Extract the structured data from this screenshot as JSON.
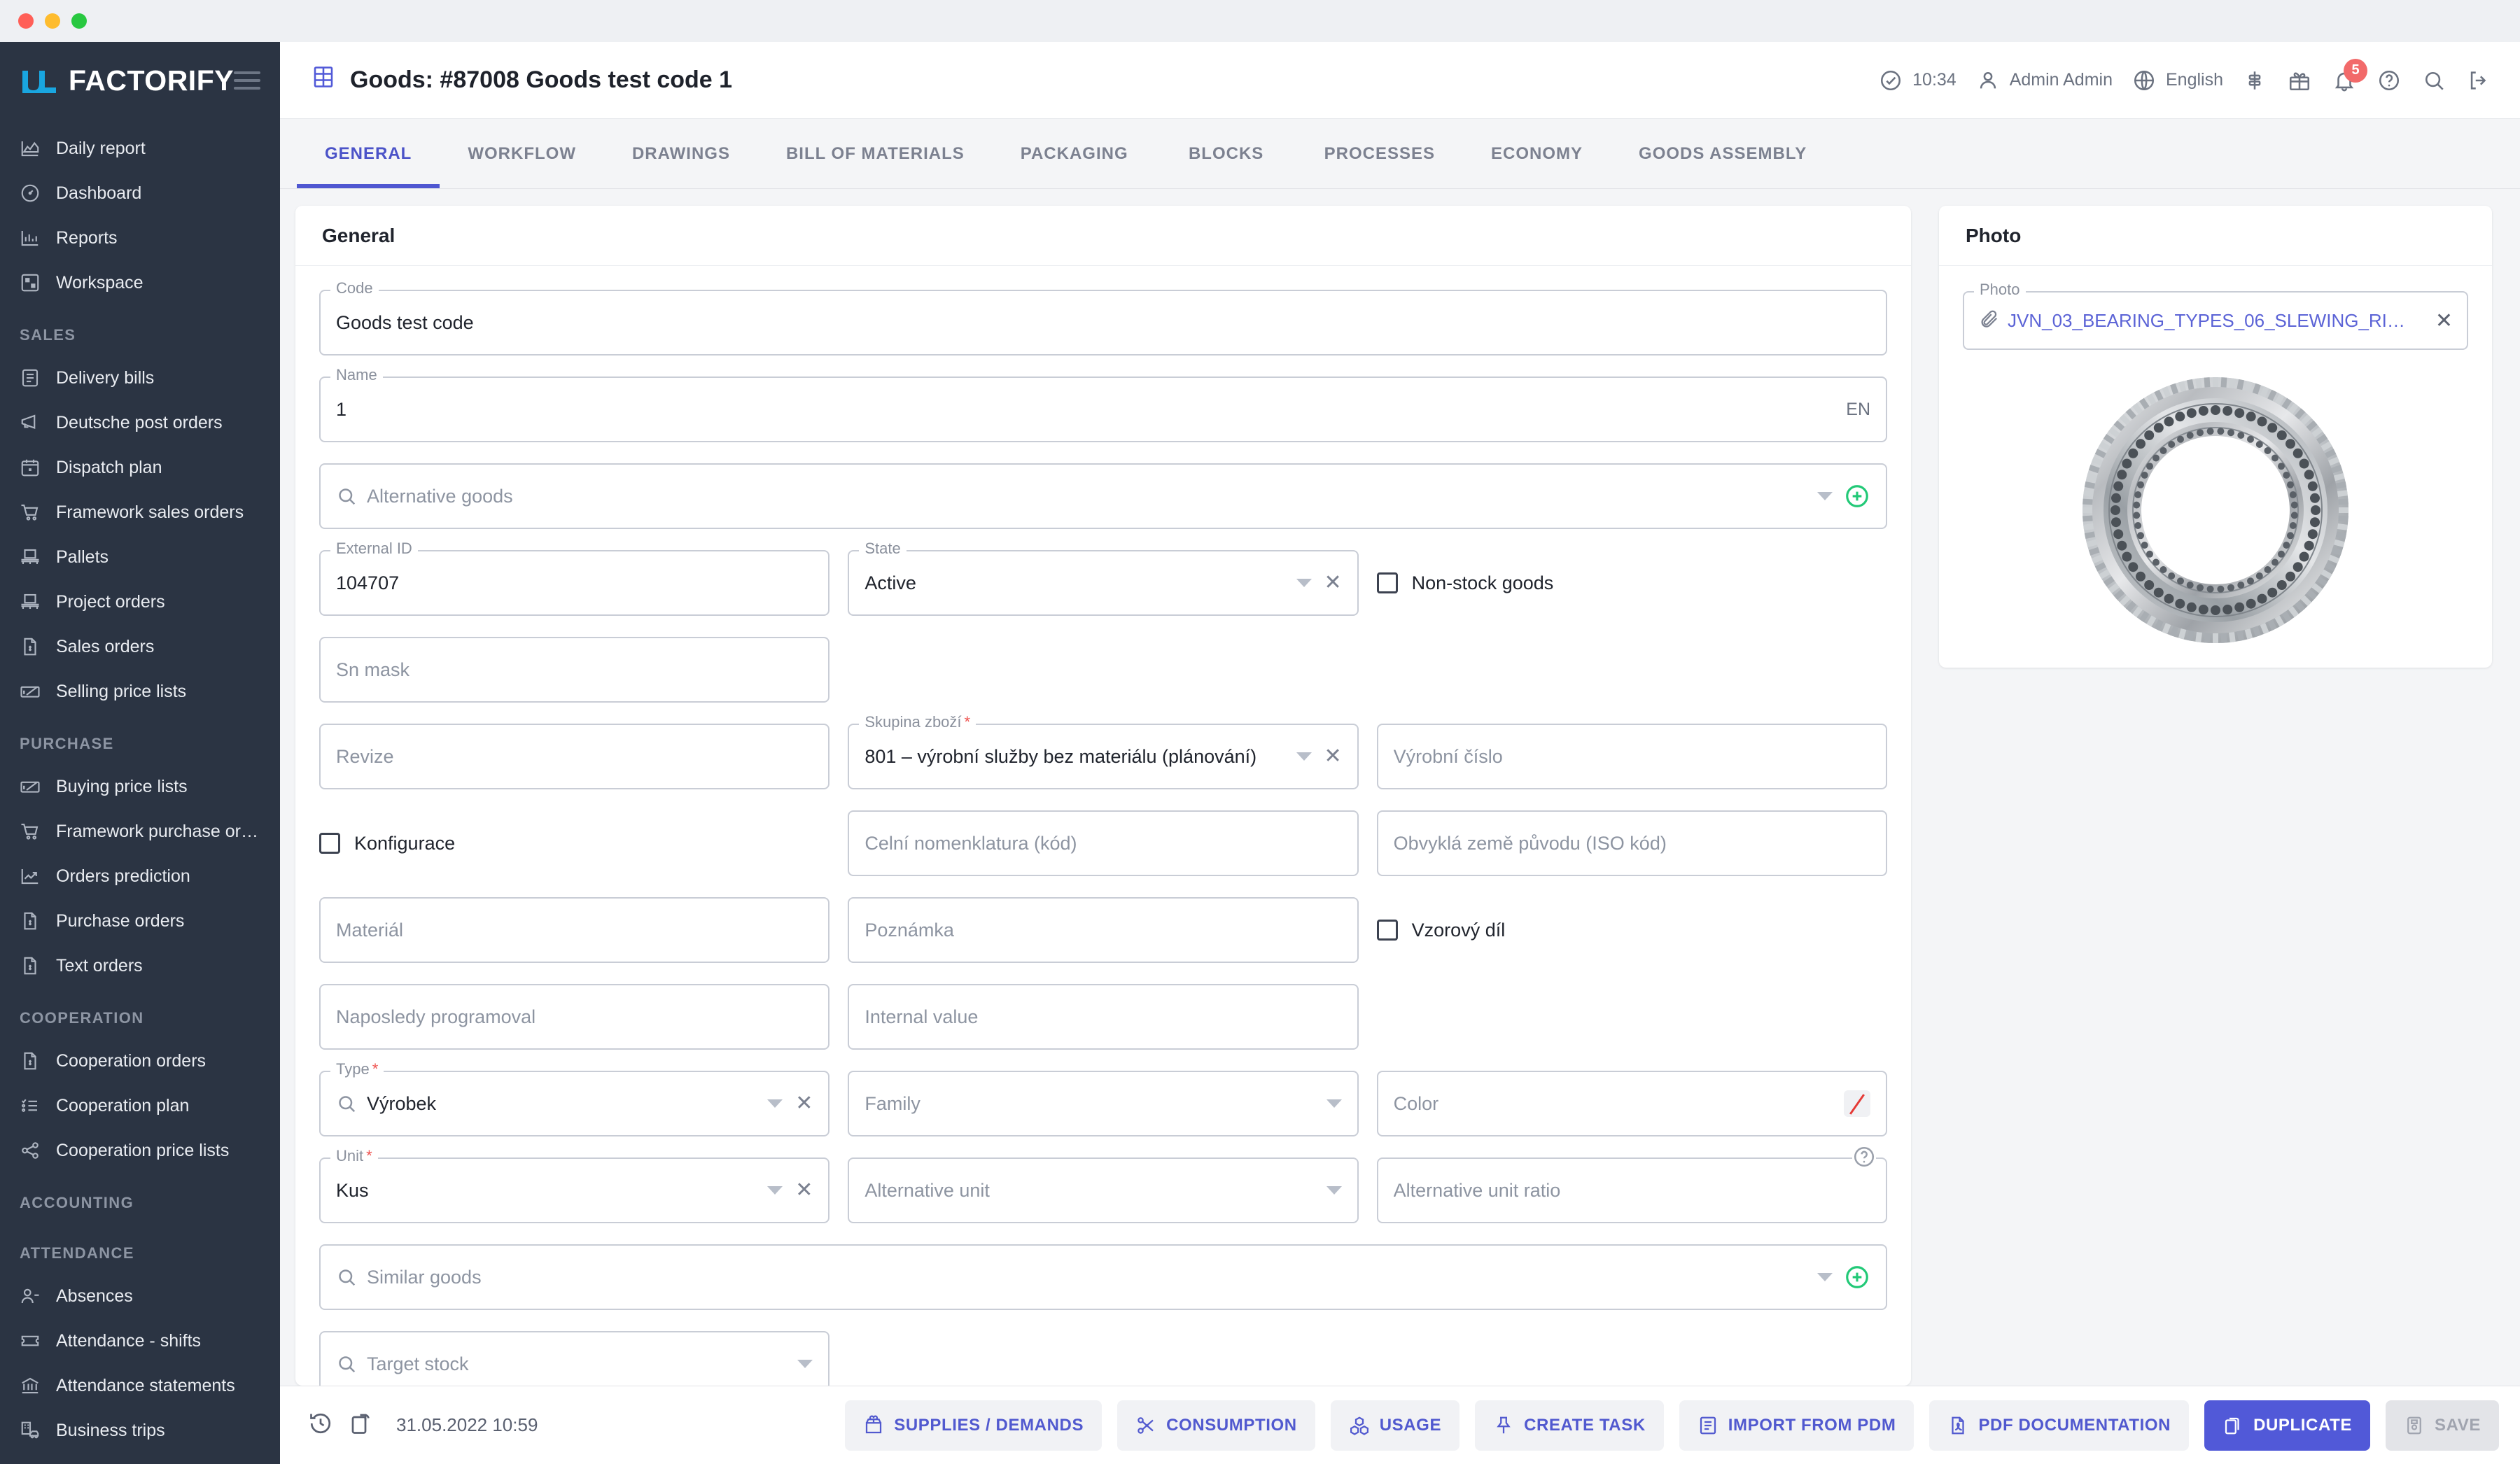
{
  "window": {
    "traffic_lights": [
      "red",
      "yellow",
      "green"
    ]
  },
  "sidebar": {
    "brand": "FACTORIFY",
    "menu_icon": "hamburger-icon",
    "groups": [
      {
        "title": "",
        "items": [
          {
            "label": "Daily report",
            "icon": "area-chart-icon"
          },
          {
            "label": "Dashboard",
            "icon": "gauge-icon"
          },
          {
            "label": "Reports",
            "icon": "bar-chart-icon"
          },
          {
            "label": "Workspace",
            "icon": "workspace-icon"
          }
        ]
      },
      {
        "title": "SALES",
        "items": [
          {
            "label": "Delivery bills",
            "icon": "checklist-icon"
          },
          {
            "label": "Deutsche post orders",
            "icon": "megaphone-icon"
          },
          {
            "label": "Dispatch plan",
            "icon": "calendar-icon"
          },
          {
            "label": "Framework sales orders",
            "icon": "cart-icon"
          },
          {
            "label": "Pallets",
            "icon": "pallet-icon"
          },
          {
            "label": "Project orders",
            "icon": "pallet-icon"
          },
          {
            "label": "Sales orders",
            "icon": "invoice-icon"
          },
          {
            "label": "Selling price lists",
            "icon": "price-tag-icon"
          }
        ]
      },
      {
        "title": "PURCHASE",
        "items": [
          {
            "label": "Buying price lists",
            "icon": "price-tag-icon"
          },
          {
            "label": "Framework purchase ord…",
            "icon": "cart-icon"
          },
          {
            "label": "Orders prediction",
            "icon": "trend-icon"
          },
          {
            "label": "Purchase orders",
            "icon": "invoice-icon"
          },
          {
            "label": "Text orders",
            "icon": "invoice-icon"
          }
        ]
      },
      {
        "title": "COOPERATION",
        "items": [
          {
            "label": "Cooperation orders",
            "icon": "invoice-icon"
          },
          {
            "label": "Cooperation plan",
            "icon": "checklist-icon"
          },
          {
            "label": "Cooperation price lists",
            "icon": "share-icon"
          }
        ]
      },
      {
        "title": "ACCOUNTING",
        "items": []
      },
      {
        "title": "ATTENDANCE",
        "items": [
          {
            "label": "Absences",
            "icon": "user-minus-icon"
          },
          {
            "label": "Attendance - shifts",
            "icon": "ticket-icon"
          },
          {
            "label": "Attendance statements",
            "icon": "bank-icon"
          },
          {
            "label": "Business trips",
            "icon": "car-icon"
          }
        ]
      }
    ]
  },
  "topbar": {
    "title": "Goods: #87008 Goods test code 1",
    "title_icon": "table-icon",
    "status_icon": "check-circle-icon",
    "time": "10:34",
    "user_icon": "user-icon",
    "user": "Admin Admin",
    "globe_icon": "globe-icon",
    "language": "English",
    "filter_icon": "sliders-icon",
    "gift_icon": "gift-icon",
    "bell_icon": "bell-icon",
    "notifications": "5",
    "help_icon": "question-circle-icon",
    "search_icon": "search-icon",
    "logout_icon": "logout-icon"
  },
  "tabs": [
    {
      "label": "GENERAL",
      "active": true
    },
    {
      "label": "WORKFLOW",
      "active": false
    },
    {
      "label": "DRAWINGS",
      "active": false
    },
    {
      "label": "BILL OF MATERIALS",
      "active": false
    },
    {
      "label": "PACKAGING",
      "active": false
    },
    {
      "label": "BLOCKS",
      "active": false
    },
    {
      "label": "PROCESSES",
      "active": false
    },
    {
      "label": "ECONOMY",
      "active": false
    },
    {
      "label": "GOODS ASSEMBLY",
      "active": false
    }
  ],
  "general": {
    "card_title": "General",
    "code": {
      "label": "Code",
      "value": "Goods test code"
    },
    "name": {
      "label": "Name",
      "value": "1",
      "suffix": "EN"
    },
    "alternative_goods": {
      "placeholder": "Alternative goods",
      "search_icon": "search-icon",
      "add_icon": "plus-circle-icon"
    },
    "external_id": {
      "label": "External ID",
      "value": "104707"
    },
    "state": {
      "label": "State",
      "value": "Active"
    },
    "non_stock_goods": {
      "label": "Non-stock goods",
      "checked": false
    },
    "sn_mask": {
      "placeholder": "Sn mask"
    },
    "revize": {
      "placeholder": "Revize"
    },
    "skupina_zbozi": {
      "label": "Skupina zboží",
      "required": true,
      "value": "801 – výrobní služby bez materiálu (plánování)"
    },
    "vyrobni_cislo": {
      "placeholder": "Výrobní číslo"
    },
    "konfigurace": {
      "label": "Konfigurace",
      "checked": false
    },
    "celni_nomenklatura": {
      "placeholder": "Celní nomenklatura (kód)"
    },
    "obvykla_zeme": {
      "placeholder": "Obvyklá země původu (ISO kód)"
    },
    "material": {
      "placeholder": "Materiál"
    },
    "poznamka": {
      "placeholder": "Poznámka"
    },
    "vzorovy_dil": {
      "label": "Vzorový díl",
      "checked": false
    },
    "naposledy_programoval": {
      "placeholder": "Naposledy programoval"
    },
    "internal_value": {
      "placeholder": "Internal value"
    },
    "type": {
      "label": "Type",
      "required": true,
      "value": "Výrobek"
    },
    "family": {
      "placeholder": "Family"
    },
    "color": {
      "placeholder": "Color",
      "swatch": "#e53935"
    },
    "unit": {
      "label": "Unit",
      "required": true,
      "value": "Kus"
    },
    "alternative_unit": {
      "placeholder": "Alternative unit"
    },
    "alternative_unit_ratio": {
      "placeholder": "Alternative unit ratio",
      "help_icon": "question-circle-icon"
    },
    "similar_goods": {
      "placeholder": "Similar goods",
      "search_icon": "search-icon",
      "add_icon": "plus-circle-icon"
    },
    "target_stock": {
      "placeholder": "Target stock",
      "search_icon": "search-icon"
    }
  },
  "photo": {
    "card_title": "Photo",
    "field_label": "Photo",
    "file_name": "JVN_03_BEARING_TYPES_06_SLEWING_RI…",
    "clip_icon": "paperclip-icon",
    "remove_icon": "close-icon",
    "image_alt": "slewing-ring-bearing-photo"
  },
  "bottombar": {
    "history_icon": "history-icon",
    "copy_icon": "duplicate-small-icon",
    "timestamp": "31.05.2022 10:59",
    "buttons": [
      {
        "label": "SUPPLIES / DEMANDS",
        "icon": "supplies-icon",
        "style": "default"
      },
      {
        "label": "CONSUMPTION",
        "icon": "scissors-icon",
        "style": "default"
      },
      {
        "label": "USAGE",
        "icon": "cubes-icon",
        "style": "default"
      },
      {
        "label": "CREATE TASK",
        "icon": "pin-icon",
        "style": "default"
      },
      {
        "label": "IMPORT FROM PDM",
        "icon": "list-icon",
        "style": "default"
      },
      {
        "label": "PDF DOCUMENTATION",
        "icon": "pdf-icon",
        "style": "default"
      },
      {
        "label": "DUPLICATE",
        "icon": "duplicate-icon",
        "style": "primary"
      },
      {
        "label": "SAVE",
        "icon": "save-icon",
        "style": "disabled"
      }
    ]
  },
  "colors": {
    "accent": "#5159d8",
    "sidebar_bg": "#2b3443",
    "brand_blue": "#19a6e0",
    "required": "#ef5350",
    "badge": "#f26a6a",
    "success": "#2ecc71"
  }
}
